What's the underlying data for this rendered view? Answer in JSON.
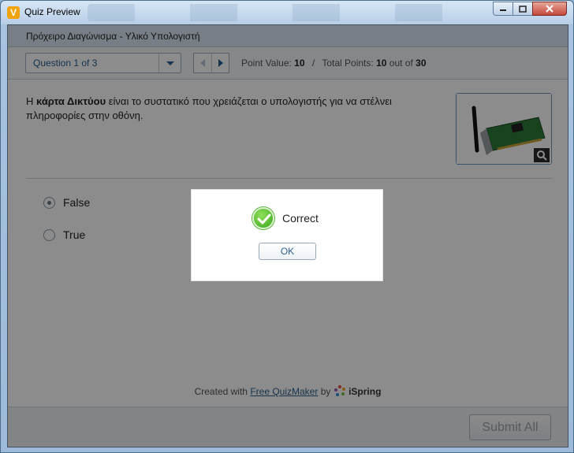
{
  "window": {
    "title": "Quiz Preview",
    "app_icon_glyph": "V",
    "controls": [
      "minimize-icon",
      "maximize-icon",
      "close-icon"
    ]
  },
  "quiz": {
    "title": "Πρόχειρο Διαγώνισμα - Υλικό Υπολογιστή",
    "question_selector": "Question 1 of 3",
    "points": {
      "point_value_label": "Point Value:",
      "point_value": "10",
      "separator": "/",
      "total_points_label": "Total Points:",
      "total_points": "10",
      "out_of_label": "out of",
      "out_of": "30"
    },
    "question": {
      "prefix": "Η ",
      "bold": "κάρτα Δικτύου",
      "suffix": " είναι το συστατικό που χρειάζεται ο υπολογιστής για να στέλνει πληροφορίες στην οθόνη."
    },
    "image_icon": "network-card-image",
    "options": [
      {
        "label": "False",
        "selected": true
      },
      {
        "label": "True",
        "selected": false
      }
    ],
    "footer": {
      "created_with": "Created with",
      "link_text": "Free QuizMaker",
      "by": "by",
      "brand": "iSpring"
    },
    "submit_label": "Submit All"
  },
  "dialog": {
    "message": "Correct",
    "ok_label": "OK",
    "icon": "check-circle-icon",
    "accent": "#3aa51c"
  }
}
